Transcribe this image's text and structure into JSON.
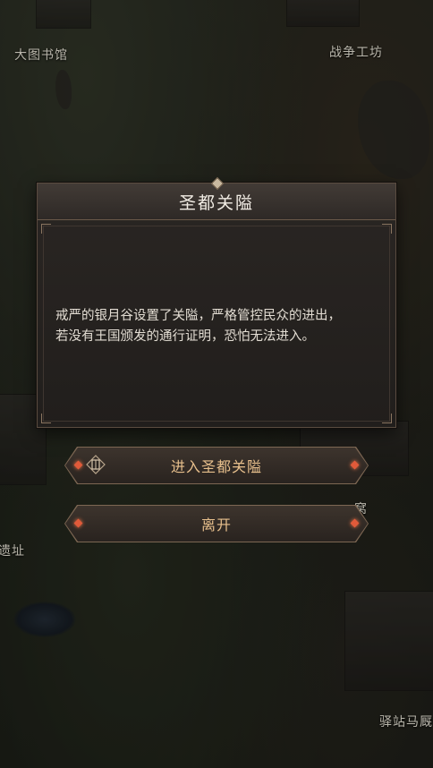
{
  "map_labels": {
    "library": "大图书馆",
    "workshop": "战争工坊",
    "ruins_partial": "遗址",
    "station": "驿站马厩",
    "hidden_partial": "窝"
  },
  "dialog": {
    "title": "圣都关隘",
    "lines": [
      "戒严的银月谷设置了关隘，严格管控民众的进出，",
      "若没有王国颁发的通行证明，恐怕无法进入。"
    ]
  },
  "buttons": {
    "enter_label": "进入圣都关隘",
    "enter_icon": "gate-icon",
    "leave_label": "离开"
  },
  "colors": {
    "title_text": "#f1ece4",
    "button_text": "#e7bf8c",
    "gem_accent": "#e05a3a"
  }
}
